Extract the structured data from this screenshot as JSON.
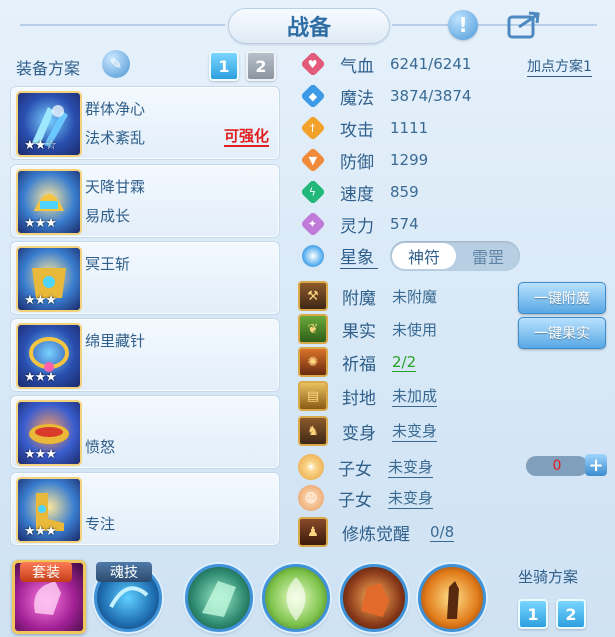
{
  "title": "战备",
  "left": {
    "plan_title": "装备方案",
    "plan_buttons": [
      "1",
      "2"
    ],
    "equipment": [
      {
        "name": "群体净心",
        "sub": "法术紊乱",
        "tag": "可强化",
        "stars": "★★☆"
      },
      {
        "name": "天降甘霖",
        "sub": "易成长",
        "tag": "",
        "stars": "★★★"
      },
      {
        "name": "冥王斩",
        "sub": "",
        "tag": "",
        "stars": "★★★"
      },
      {
        "name": "绵里藏针",
        "sub": "",
        "tag": "",
        "stars": "★★★"
      },
      {
        "name": "",
        "sub": "愤怒",
        "tag": "",
        "stars": "★★★"
      },
      {
        "name": "",
        "sub": "专注",
        "tag": "",
        "stars": "★★★"
      }
    ]
  },
  "stats": {
    "jiadian": "加点方案1",
    "items": [
      {
        "label": "气血",
        "value": "6241/6241",
        "color": "#e35b7a",
        "icon": "heart-icon"
      },
      {
        "label": "魔法",
        "value": "3874/3874",
        "color": "#3d9ae6",
        "icon": "mana-icon"
      },
      {
        "label": "攻击",
        "value": "1111",
        "color": "#f2a12a",
        "icon": "sword-icon"
      },
      {
        "label": "防御",
        "value": "1299",
        "color": "#f08b3b",
        "icon": "shield-icon"
      },
      {
        "label": "速度",
        "value": "859",
        "color": "#22b87a",
        "icon": "lightning-icon"
      },
      {
        "label": "灵力",
        "value": "574",
        "color": "#c07ad8",
        "icon": "spirit-icon"
      }
    ],
    "xingxiang": {
      "label": "星象",
      "on": "神符",
      "off": "雷罡"
    }
  },
  "extras": [
    {
      "label": "附魔",
      "value": "未附魔",
      "style": "plain"
    },
    {
      "label": "果实",
      "value": "未使用",
      "style": "plain"
    },
    {
      "label": "祈福",
      "value": "2/2",
      "style": "green"
    },
    {
      "label": "封地",
      "value": "未加成",
      "style": "ul"
    },
    {
      "label": "变身",
      "value": "未变身",
      "style": "ul"
    },
    {
      "label": "子女",
      "value": "未变身",
      "style": "ul"
    },
    {
      "label": "子女",
      "value": "未变身",
      "style": "ul"
    },
    {
      "label": "修炼觉醒",
      "value": "0/8",
      "style": "ul"
    }
  ],
  "buttons": {
    "fumo": "一键附魔",
    "guoshi": "一键果实"
  },
  "counter": {
    "value": "0",
    "plus": "+"
  },
  "bottom": {
    "suit": "套装",
    "soul": "魂技",
    "mount_title": "坐骑方案",
    "mount_buttons": [
      "1",
      "2"
    ]
  }
}
